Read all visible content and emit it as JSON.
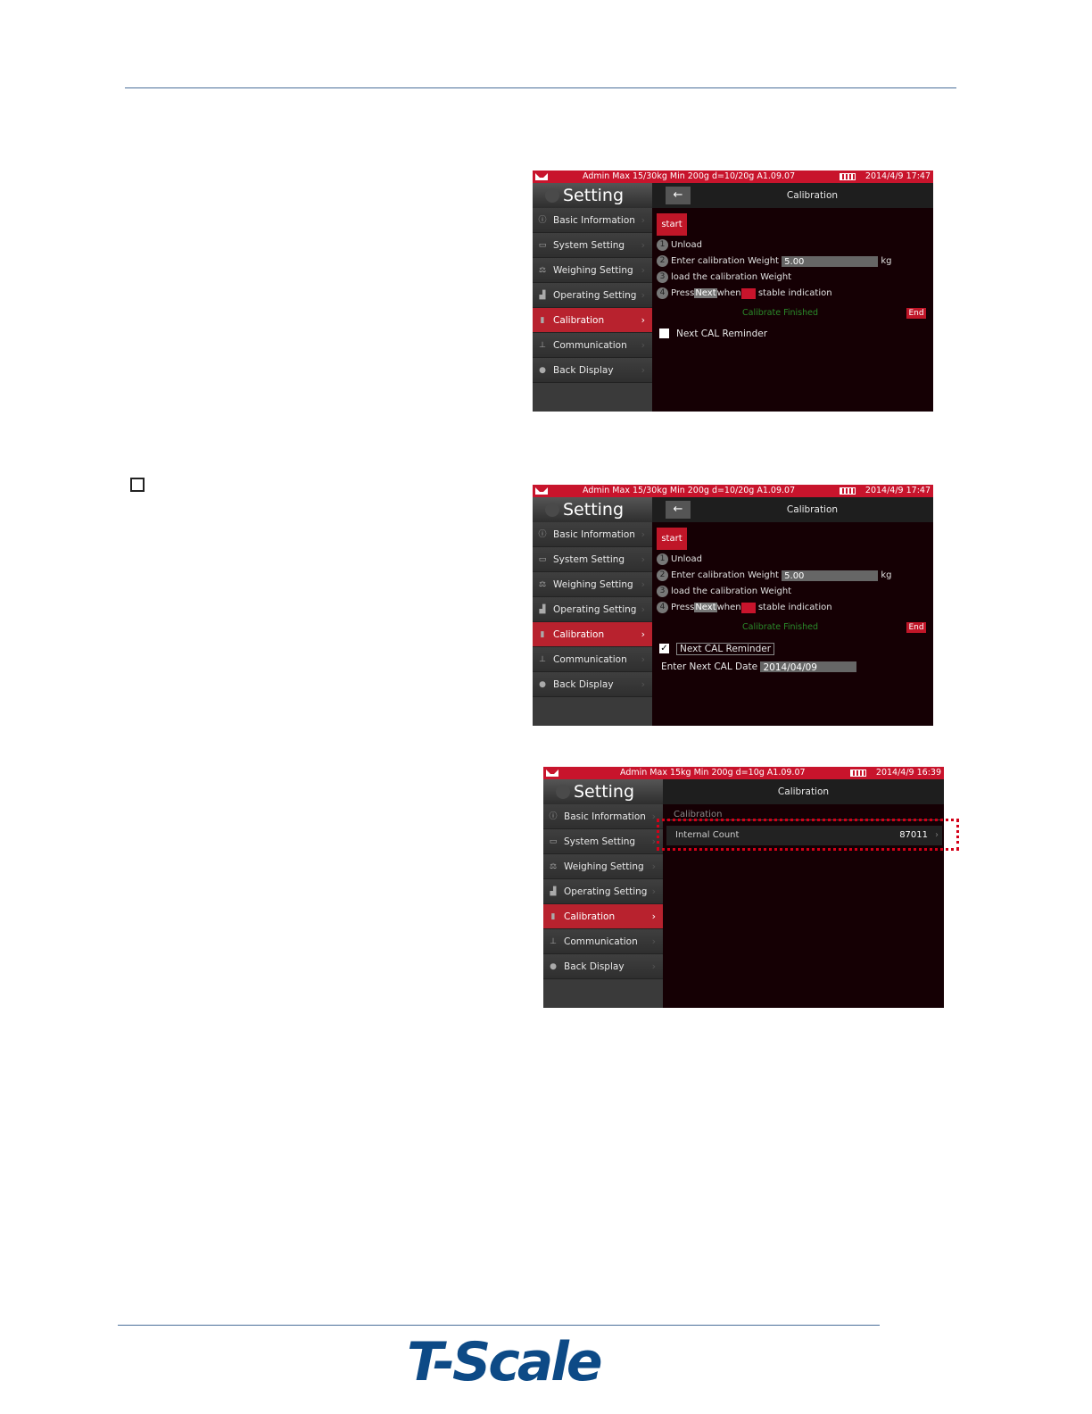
{
  "status": {
    "shot1": {
      "info": "Admin   Max 15/30kg Min 200g d=10/20g    A1.09.07",
      "datetime": "2014/4/9 17:47"
    },
    "shot2": {
      "info": "Admin   Max 15/30kg Min 200g d=10/20g    A1.09.07",
      "datetime": "2014/4/9 17:47"
    },
    "shot3": {
      "info": "Admin   Max 15kg Min 200g d=10g    A1.09.07",
      "datetime": "2014/4/9 16:39"
    }
  },
  "sidebar": {
    "title": "Setting",
    "items": [
      {
        "label": "Basic Information",
        "icon": "info-icon"
      },
      {
        "label": "System Setting",
        "icon": "monitor-icon"
      },
      {
        "label": "Weighing Setting",
        "icon": "scale-icon"
      },
      {
        "label": "Operating Setting",
        "icon": "hand-icon"
      },
      {
        "label": "Calibration",
        "icon": "weight-icon"
      },
      {
        "label": "Communication",
        "icon": "network-icon"
      },
      {
        "label": "Back Display",
        "icon": "person-icon"
      }
    ]
  },
  "main": {
    "title": "Calibration",
    "start_label": "start",
    "steps": {
      "s1_num": "1",
      "s1": "Unload",
      "s2_num": "2",
      "s2": "Enter  calibration Weight",
      "s2_value": "5.00",
      "s2_unit": "kg",
      "s3_num": "3",
      "s3": "load the calibration Weight",
      "s4_num": "4",
      "s4_pre": "Press",
      "s4_next": "Next",
      "s4_when": "when",
      "s4_post": "stable indication"
    },
    "finished": "Calibrate Finished",
    "end_label": "End",
    "reminder_label": "Next CAL Reminder",
    "reminder_checked_mark": "✓",
    "date_label": "Enter Next CAL Date",
    "date_value": "2014/04/09",
    "cal_section": "Calibration",
    "internal_count_label": "Internal Count",
    "internal_count_value": "87011"
  },
  "colors": {
    "accent": "#c8142c",
    "highlight_box": "#d40018",
    "finished_text": "#2a8a2a"
  }
}
